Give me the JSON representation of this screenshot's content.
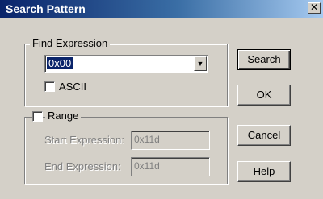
{
  "window": {
    "title": "Search Pattern",
    "close_glyph": "✕"
  },
  "find_group": {
    "legend": "Find Expression",
    "expression_value": "0x00",
    "dropdown_glyph": "▼",
    "ascii_label": "ASCII",
    "ascii_checked": false
  },
  "range_group": {
    "legend": "Range",
    "range_checked": false,
    "start_label": "Start Expression:",
    "start_value": "0x11d",
    "end_label": "End Expression:",
    "end_value": "0x11d"
  },
  "buttons": {
    "search": "Search",
    "ok": "OK",
    "cancel": "Cancel",
    "help": "Help"
  }
}
